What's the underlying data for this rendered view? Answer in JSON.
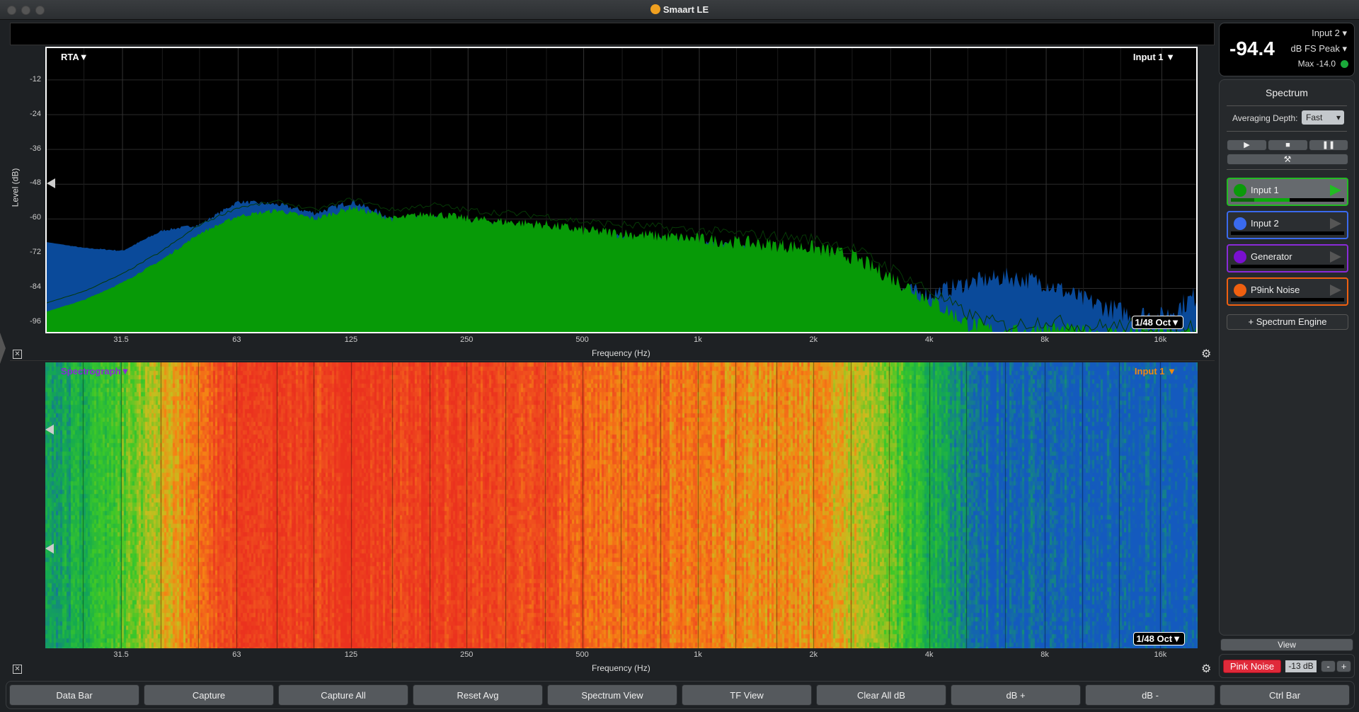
{
  "window": {
    "title": "Smaart LE"
  },
  "rta": {
    "mode_label": "RTA▼",
    "input_label": "Input 1 ▼",
    "resolution": "1/48 Oct▼",
    "ylabel": "Level (dB)",
    "xlabel": "Frequency (Hz)"
  },
  "spectrograph": {
    "mode_label": "Spectrograph▼",
    "input_label": "Input 1 ▼",
    "resolution": "1/48 Oct▼",
    "xlabel": "Frequency (Hz)"
  },
  "meter": {
    "value": "-94.4",
    "input": "Input 2",
    "unit": "dB FS Peak",
    "max": "Max -14.0",
    "status_color": "#1aaa3a"
  },
  "spectrum_panel": {
    "title": "Spectrum",
    "avg_label": "Averaging Depth:",
    "avg_value": "Fast",
    "add_engine": "+ Spectrum Engine",
    "channels": [
      {
        "name": "Input 1",
        "color": "#0a9a0a",
        "border": "#22bb22",
        "active": true,
        "meter": 0.52
      },
      {
        "name": "Input 2",
        "color": "#3a6aee",
        "border": "#3a6aee",
        "active": false,
        "meter": 0
      },
      {
        "name": "Generator",
        "color": "#7a10d0",
        "border": "#8a2ad8",
        "active": false,
        "meter": 0
      },
      {
        "name": "P9ink Noise",
        "color": "#f06010",
        "border": "#f06010",
        "active": false,
        "meter": 0
      }
    ]
  },
  "view_label": "View",
  "generator": {
    "label": "Pink Noise",
    "level": "-13 dB",
    "minus": "-",
    "plus": "+"
  },
  "bottom_buttons": [
    "Data Bar",
    "Capture",
    "Capture All",
    "Reset Avg",
    "Spectrum View",
    "TF View",
    "Clear All dB",
    "dB +",
    "dB -",
    "Ctrl Bar"
  ],
  "chart_data": {
    "type": "area",
    "xscale": "log",
    "xlim": [
      20,
      20000
    ],
    "ylim": [
      -100,
      0
    ],
    "xlabel": "Frequency (Hz)",
    "ylabel": "Level (dB)",
    "xticks": [
      "31.5",
      "63",
      "125",
      "250",
      "500",
      "1k",
      "2k",
      "4k",
      "8k",
      "16k"
    ],
    "yticks": [
      "-12",
      "-24",
      "-36",
      "-48",
      "-60",
      "-72",
      "-84",
      "-96"
    ],
    "x": [
      20,
      25,
      31.5,
      40,
      50,
      63,
      80,
      100,
      125,
      160,
      200,
      250,
      315,
      400,
      500,
      630,
      800,
      1000,
      1250,
      1600,
      2000,
      2500,
      3150,
      4000,
      5000,
      6300,
      8000,
      10000,
      12500,
      16000,
      20000
    ],
    "series": [
      {
        "name": "Input 1",
        "color": "#0a9a0a",
        "values": [
          -92,
          -88,
          -82,
          -74,
          -65,
          -59,
          -57,
          -60,
          -56,
          -60,
          -58,
          -60,
          -61,
          -62,
          -64,
          -65,
          -66,
          -67,
          -68,
          -69,
          -70,
          -73,
          -80,
          -88,
          -96,
          -100,
          -98,
          -100,
          -100,
          -100,
          -100
        ]
      },
      {
        "name": "Input 2",
        "color": "#0a4a9a",
        "values": [
          -68,
          -70,
          -71,
          -64,
          -62,
          -54,
          -55,
          -58,
          -54,
          -60,
          -60,
          -62,
          -63,
          -64,
          -66,
          -67,
          -68,
          -69,
          -70,
          -72,
          -74,
          -78,
          -84,
          -86,
          -82,
          -80,
          -82,
          -88,
          -92,
          -94,
          -86
        ]
      }
    ]
  }
}
